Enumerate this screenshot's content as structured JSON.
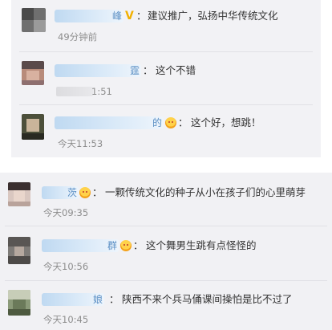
{
  "top_panel": {
    "comments": [
      {
        "name_tail": "峰",
        "verified_icon": "V",
        "separator": "：",
        "text": "建议推广，弘扬中华传统文化",
        "time": "49分钟前"
      },
      {
        "name_tail": "霆",
        "separator": "：",
        "text": "这个不错",
        "time": "1:51"
      },
      {
        "name_tail": "的",
        "emoji": "smile-emoji",
        "separator": "：",
        "text": "这个好，想跳！",
        "time": "今天11:53"
      }
    ]
  },
  "bottom_panel": {
    "comments": [
      {
        "name_tail": "茨",
        "emoji": "smile-emoji",
        "separator": "：",
        "text": "一颗传统文化的种子从小在孩子们的心里萌芽",
        "time": "今天09:35"
      },
      {
        "name_tail": "群",
        "emoji": "smile-emoji",
        "separator": "：",
        "text": "这个舞男生跳有点怪怪的",
        "time": "今天10:56"
      },
      {
        "name_tail": "娘",
        "separator": "：",
        "text": "陕西不来个兵马俑课间操怕是比不过了",
        "time": "今天10:45"
      }
    ]
  }
}
